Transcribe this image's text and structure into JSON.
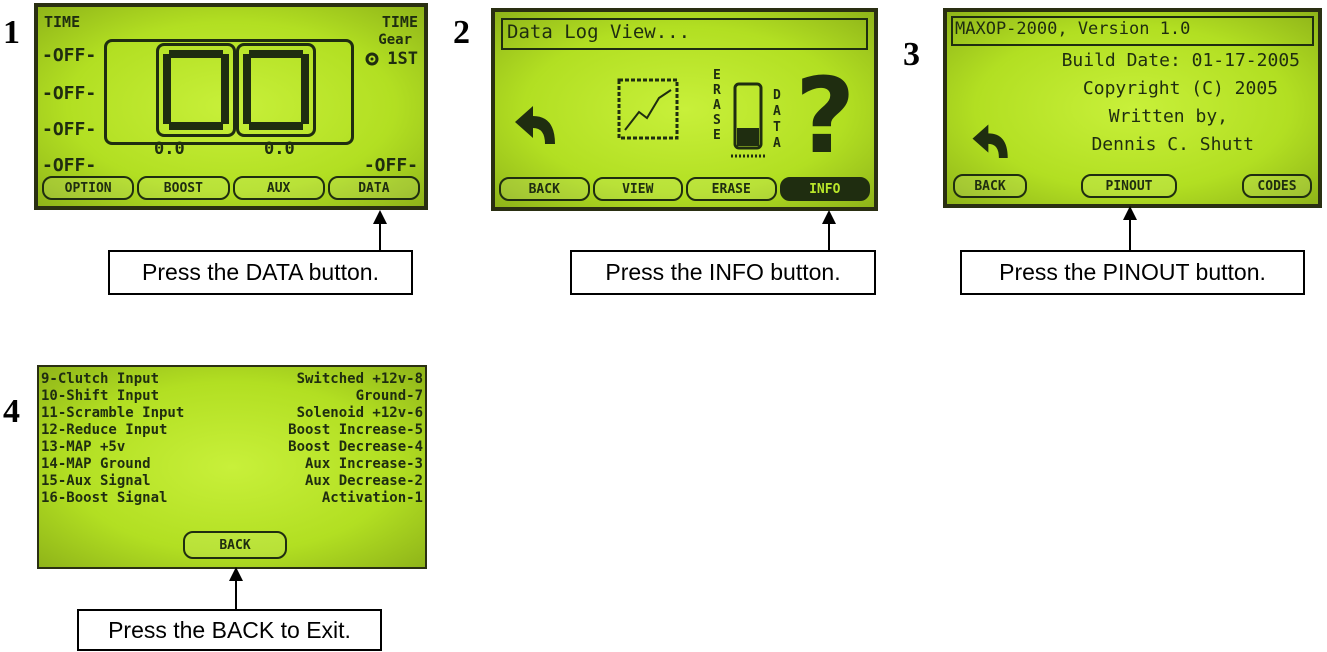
{
  "steps": [
    {
      "number": "1",
      "screen": {
        "time_left": "TIME",
        "time_right": "TIME",
        "off_rows": [
          "-OFF-",
          "-OFF-",
          "-OFF-",
          "-OFF-"
        ],
        "gear_label": "Gear",
        "gear_value": "1ST",
        "reading_left": "0.0",
        "reading_right": "0.0",
        "off_right": "-OFF-",
        "digit_left": "0",
        "digit_right": "0",
        "buttons": [
          "OPTION",
          "BOOST",
          "AUX",
          "DATA"
        ]
      },
      "instruction": "Press the DATA button."
    },
    {
      "number": "2",
      "screen": {
        "title": "Data Log View...",
        "erase_vertical": "ERASE",
        "data_vertical": "DATA",
        "help_glyph": "?",
        "buttons": [
          "BACK",
          "VIEW",
          "ERASE",
          "INFO"
        ]
      },
      "instruction": "Press the INFO button."
    },
    {
      "number": "3",
      "screen": {
        "title": "MAXOP-2000, Version 1.0",
        "lines": [
          "Build Date: 01-17-2005",
          "Copyright (C) 2005",
          "Written by,",
          "Dennis C. Shutt"
        ],
        "buttons": [
          "BACK",
          "PINOUT",
          "CODES"
        ]
      },
      "instruction": "Press the PINOUT button."
    },
    {
      "number": "4",
      "screen": {
        "pins_left": [
          "9-Clutch Input",
          "10-Shift Input",
          "11-Scramble Input",
          "12-Reduce Input",
          "13-MAP +5v",
          "14-MAP Ground",
          "15-Aux Signal",
          "16-Boost Signal"
        ],
        "pins_right": [
          "Switched +12v-8",
          "Ground-7",
          "Solenoid +12v-6",
          "Boost Increase-5",
          "Boost Decrease-4",
          "Aux Increase-3",
          "Aux Decrease-2",
          "Activation-1"
        ],
        "buttons": [
          "BACK"
        ]
      },
      "instruction": "Press the BACK to Exit."
    }
  ],
  "icons": {
    "back": "back-arrow-icon",
    "graph": "line-graph-icon",
    "erase": "memory-chip-icon",
    "gear": "gear-icon"
  }
}
